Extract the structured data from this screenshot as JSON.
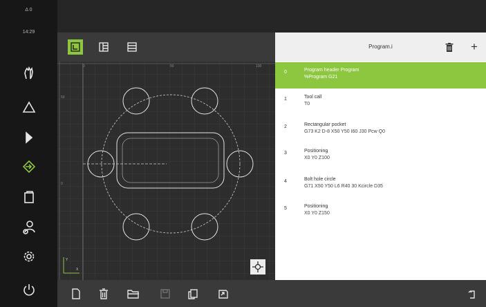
{
  "sidebar": {
    "status_text": "Δ 0",
    "time": "14:29",
    "items": [
      "hand-icon",
      "triangle-icon",
      "play-icon",
      "target-icon",
      "clipboard-icon",
      "user-settings-icon",
      "gear-icon",
      "power-icon"
    ]
  },
  "simulation": {
    "toolbar_views": [
      "single-view-icon",
      "split-view-icon",
      "list-view-icon"
    ],
    "active_view": 0,
    "ruler_x_labels": [
      "0",
      "50",
      "100"
    ],
    "ruler_y_labels": [
      "50",
      "0"
    ],
    "axis_y_label": "Y",
    "axis_x_label": "X",
    "center_button": "crosshair-icon"
  },
  "program": {
    "title": "Program.i",
    "actions": [
      "trash-icon",
      "plus-icon"
    ],
    "steps": [
      {
        "index": "0",
        "name": "Program header Program",
        "params": "%Program G21",
        "selected": true
      },
      {
        "index": "1",
        "name": "Tool call",
        "params": "T0",
        "selected": false
      },
      {
        "index": "2",
        "name": "Rectangular pocket",
        "params": "G73 K2 D-8 X50 Y50 I60 J30 Pcw Q0",
        "selected": false
      },
      {
        "index": "3",
        "name": "Positioning",
        "params": "X0 Y0 Z100",
        "selected": false
      },
      {
        "index": "4",
        "name": "Bolt hole circle",
        "params": "G71 X50 Y50 L6 R40 30 Kcircle D35",
        "selected": false
      },
      {
        "index": "5",
        "name": "Positioning",
        "params": "X0 Y0 Z150",
        "selected": false
      }
    ],
    "plus_label": "+"
  },
  "bottombar": {
    "buttons": [
      "new-file-icon",
      "delete-icon",
      "open-folder-icon",
      "save-icon",
      "copy-icon",
      "export-icon"
    ],
    "disabled": [
      "save-icon"
    ],
    "right_button": "undo-icon"
  },
  "colors": {
    "accent": "#8dc63f",
    "sidebar_bg": "#171717",
    "canvas_bg": "#2d2d2d",
    "list_bg": "#ffffff"
  }
}
